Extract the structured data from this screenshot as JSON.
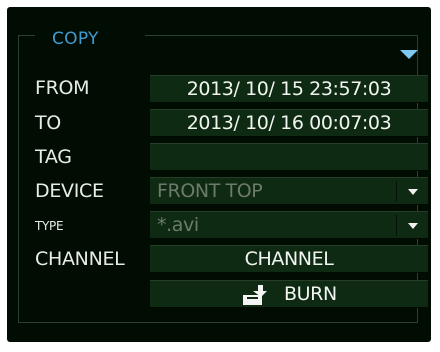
{
  "title": "COPY",
  "rows": {
    "from": {
      "label": "FROM",
      "value": "2013/ 10/ 15 23:57:03"
    },
    "to": {
      "label": "TO",
      "value": "2013/ 10/ 16 00:07:03"
    },
    "tag": {
      "label": "TAG",
      "value": ""
    },
    "device": {
      "label": "DEVICE",
      "value": "FRONT TOP"
    },
    "type": {
      "label": "TYPE",
      "value": "*.avi"
    },
    "channel": {
      "label": "CHANNEL",
      "button_label": "CHANNEL"
    }
  },
  "burn": {
    "label": "BURN",
    "icon": "burn-icon"
  },
  "colors": {
    "background": "#010c02",
    "field": "#0f2a12",
    "title": "#3f9bd0",
    "arrow": "#7ec9f2",
    "text": "#e8ece8"
  }
}
